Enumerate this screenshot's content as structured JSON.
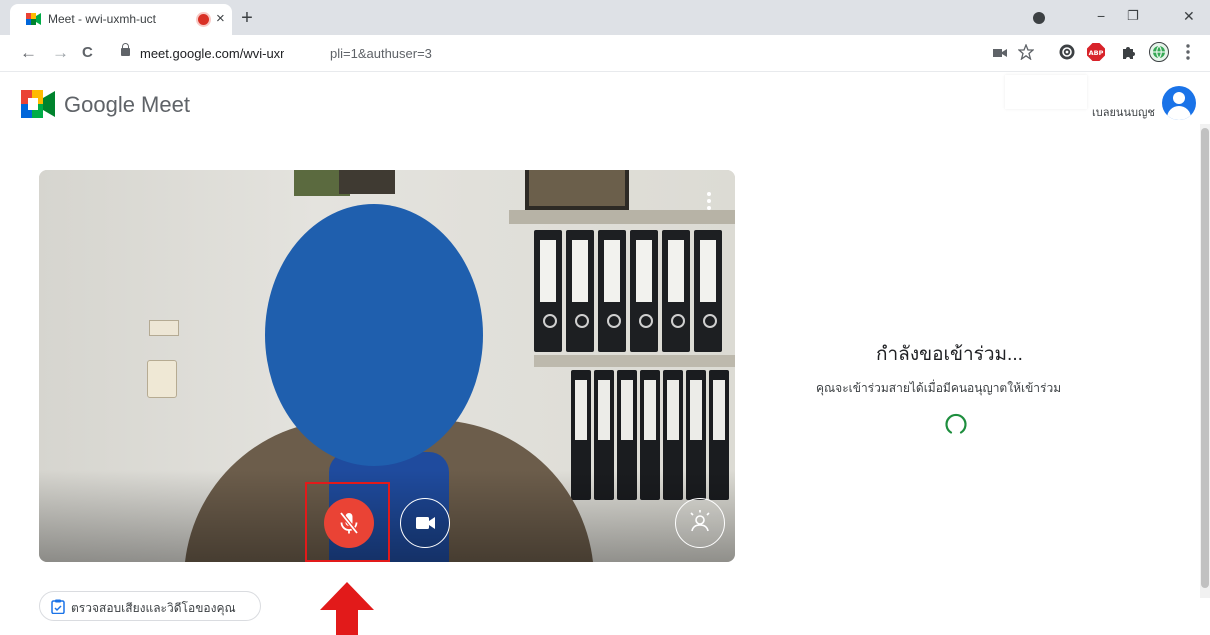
{
  "browser": {
    "tab": {
      "title": "Meet - wvi-uxmh-uct",
      "close": "×"
    },
    "new_tab": "+",
    "window": {
      "minimize": "−",
      "restore": "❐",
      "close": "✕"
    },
    "nav": {
      "back": "←",
      "forward": "→",
      "reload": "C"
    },
    "url": {
      "host": "meet.google.com/wvi-uxmh",
      "query": "pli=1&authuser=3"
    },
    "extensions": [
      "camera-icon",
      "star-icon",
      "ghostery-icon",
      "adblock-plus-icon",
      "puzzle-icon",
      "profile-globe-icon",
      "kebab-menu-icon"
    ]
  },
  "meet": {
    "brand": "Google Meet",
    "account": {
      "name": "เบลยนนบญช"
    },
    "preview": {
      "mic_state": "muted",
      "check_button": "ตรวจสอบเสียงและวิดีโอของคุณ"
    },
    "join": {
      "title": "กำลังขอเข้าร่วม...",
      "subtitle": "คุณจะเข้าร่วมสายได้เมื่อมีคนอนุญาตให้เข้าร่วม"
    }
  },
  "colors": {
    "mic_red": "#ea4335",
    "spinner": "#1e8e3e",
    "annotation_red": "#e21a1a",
    "face_blur": "#1f5fae"
  }
}
